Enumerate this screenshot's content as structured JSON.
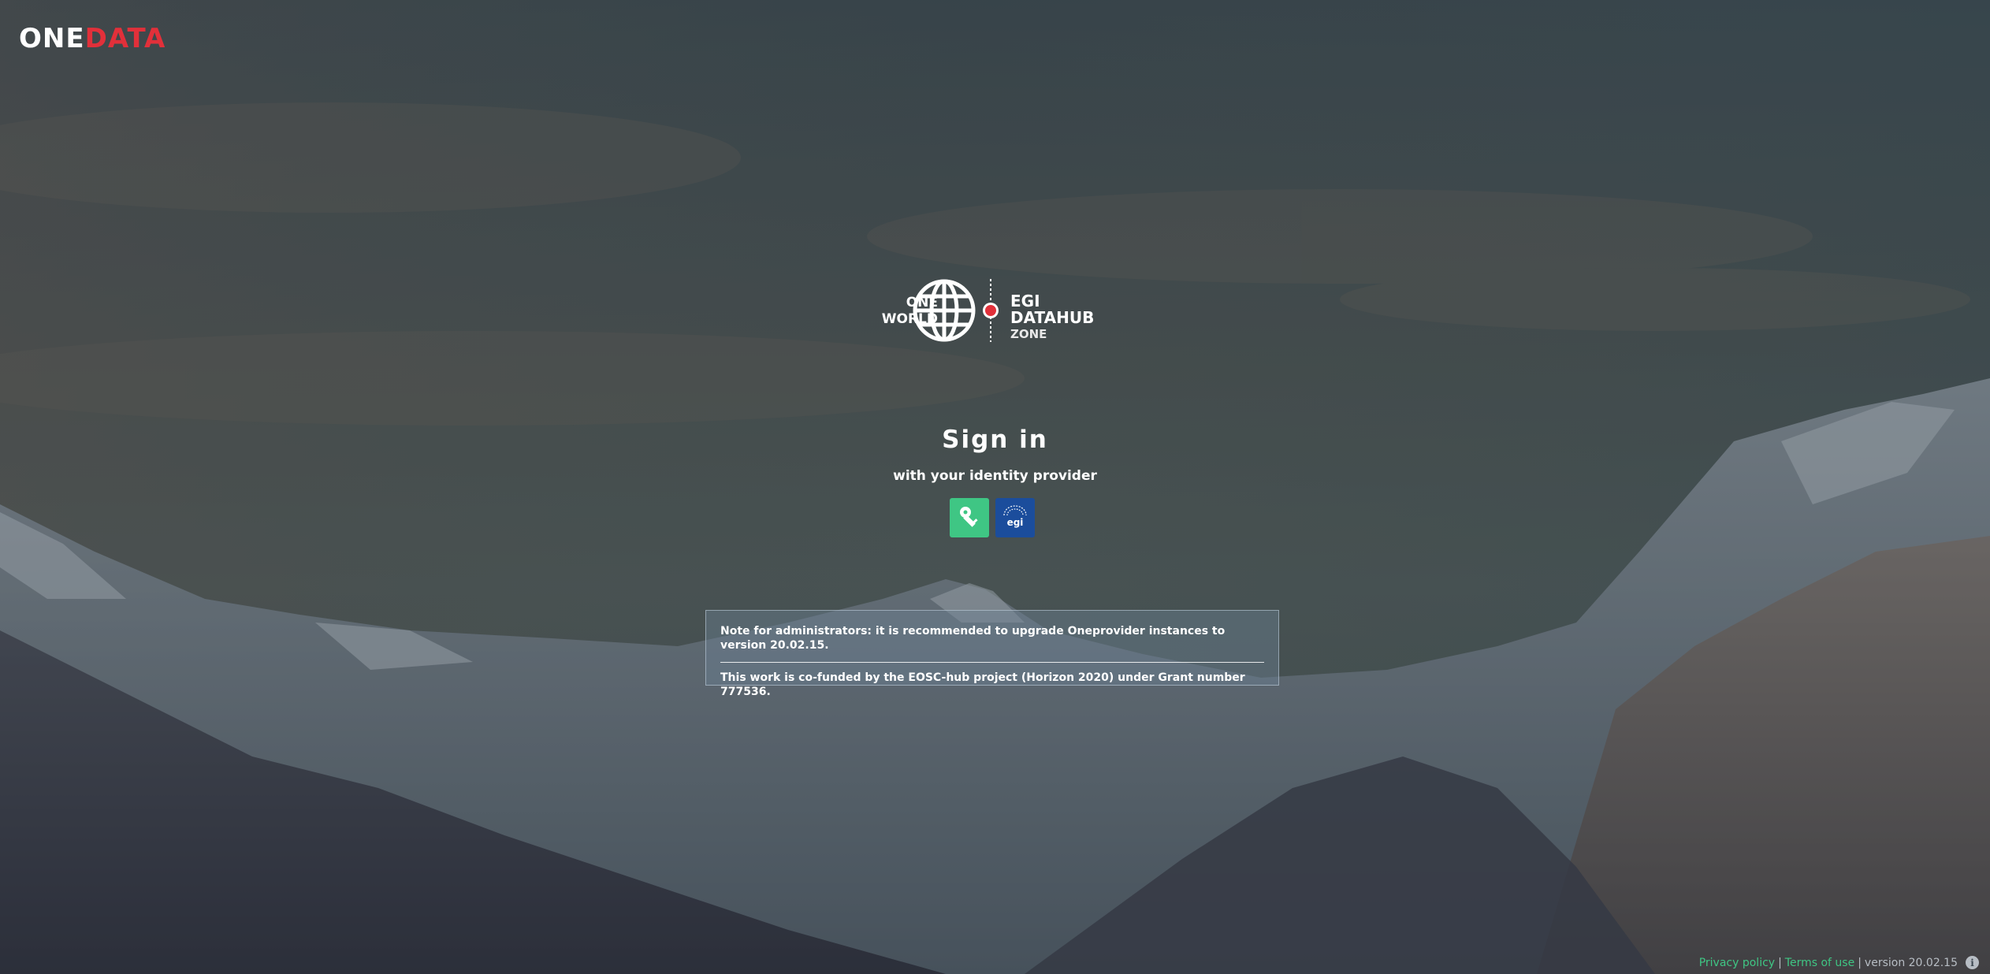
{
  "brand": {
    "one": "ONE",
    "data": "DATA"
  },
  "zone": {
    "left_line1": "ONE",
    "left_line2": "WORLD",
    "name": "EGI DATAHUB",
    "sub": "ZONE"
  },
  "signin": {
    "title": "Sign in",
    "subtitle": "with your identity provider",
    "providers": [
      {
        "icon": "key-icon",
        "color": "#3fc684"
      },
      {
        "icon": "egi-logo-icon",
        "color": "#1b4d9c"
      }
    ]
  },
  "notice": {
    "line1": "Note for administrators: it is recommended to upgrade Oneprovider instances to version 20.02.15.",
    "line2": "This work is co-funded by the EOSC-hub project (Horizon 2020) under Grant number 777536."
  },
  "footer": {
    "privacy": "Privacy policy",
    "terms": "Terms of use",
    "version": "version 20.02.15",
    "separator": "|"
  },
  "colors": {
    "accent": "#3fc684",
    "brand_red": "#e2303a",
    "egi_blue": "#1b4d9c"
  }
}
